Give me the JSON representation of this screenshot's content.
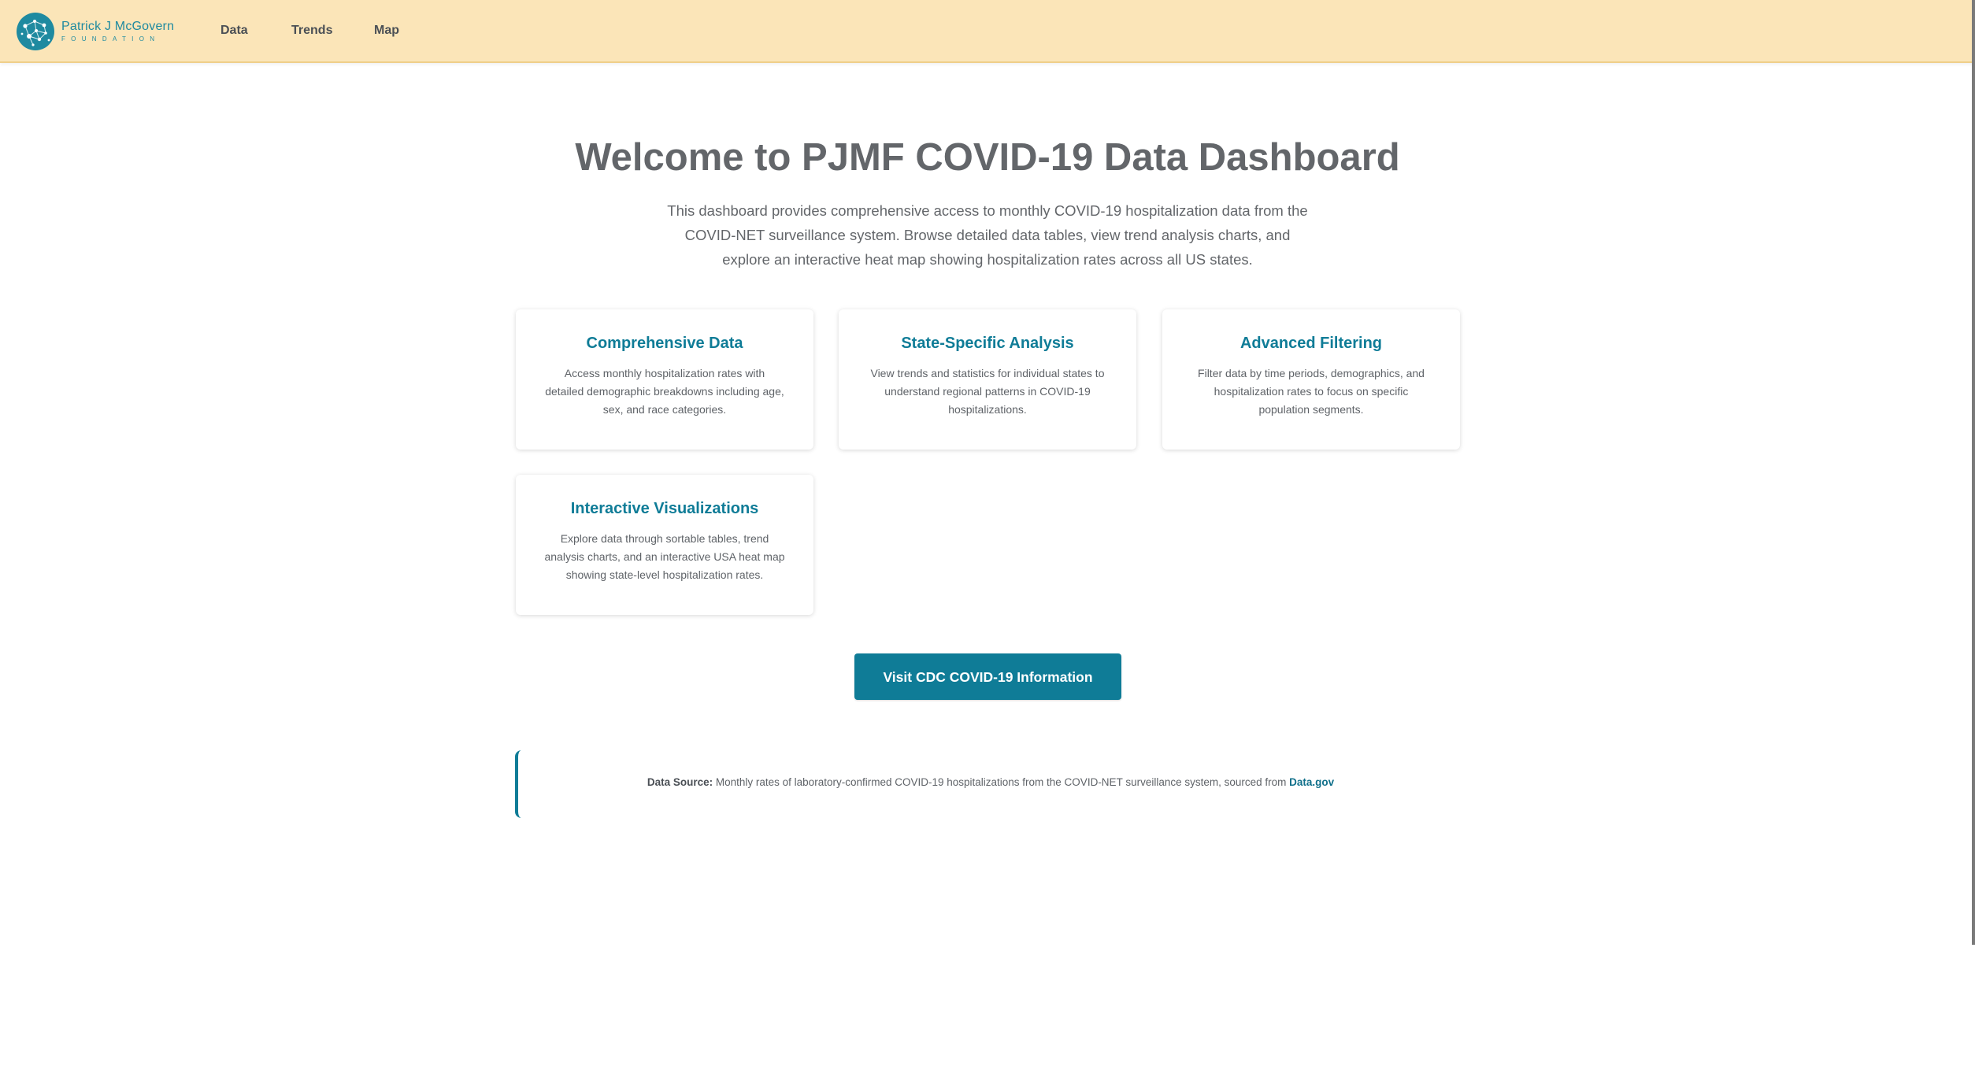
{
  "nav": {
    "logo": {
      "name": "Patrick J McGovern",
      "sub": "FOUNDATION"
    },
    "links": [
      "Data",
      "Trends",
      "Map"
    ]
  },
  "hero": {
    "title": "Welcome to PJMF COVID-19 Data Dashboard",
    "description": "This dashboard provides comprehensive access to monthly COVID-19 hospitalization data from the COVID-NET surveillance system. Browse detailed data tables, view trend analysis charts, and explore an interactive heat map showing hospitalization rates across all US states."
  },
  "features": [
    {
      "title": "Comprehensive Data",
      "text": "Access monthly hospitalization rates with detailed demographic breakdowns including age, sex, and race categories."
    },
    {
      "title": "State-Specific Analysis",
      "text": "View trends and statistics for individual states to understand regional patterns in COVID-19 hospitalizations."
    },
    {
      "title": "Advanced Filtering",
      "text": "Filter data by time periods, demographics, and hospitalization rates to focus on specific population segments."
    },
    {
      "title": "Interactive Visualizations",
      "text": "Explore data through sortable tables, trend analysis charts, and an interactive USA heat map showing state-level hospitalization rates."
    }
  ],
  "cta": {
    "label": "Visit CDC COVID-19 Information"
  },
  "source": {
    "label": "Data Source:",
    "text": " Monthly rates of laboratory-confirmed COVID-19 hospitalizations from the COVID-NET surveillance system, sourced from ",
    "link": "Data.gov"
  },
  "colors": {
    "nav_bg": "#fbe5b8",
    "accent": "#0f7c97",
    "heading": "#63666a"
  }
}
